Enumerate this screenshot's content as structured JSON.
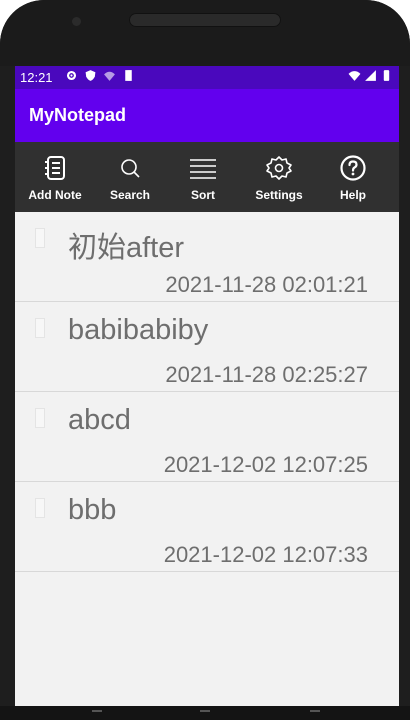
{
  "status_bar": {
    "time": "12:21"
  },
  "app_bar": {
    "title": "MyNotepad"
  },
  "toolbar": {
    "add_note": "Add Note",
    "search": "Search",
    "sort": "Sort",
    "settings": "Settings",
    "help": "Help"
  },
  "notes": [
    {
      "title": "初始after",
      "date": "2021-11-28 02:01:21"
    },
    {
      "title": "babibabiby",
      "date": "2021-11-28 02:25:27"
    },
    {
      "title": "abcd",
      "date": "2021-12-02 12:07:25"
    },
    {
      "title": "bbb",
      "date": "2021-12-02 12:07:33"
    }
  ],
  "colors": {
    "status_bar": "#4a08bd",
    "app_bar": "#6200ee",
    "toolbar": "#303030",
    "list_background": "#f2f2f2",
    "text": "#6e6e6e"
  },
  "icons": [
    "notebook-icon",
    "search-icon",
    "sort-lines-icon",
    "gear-icon",
    "help-circle-icon"
  ]
}
